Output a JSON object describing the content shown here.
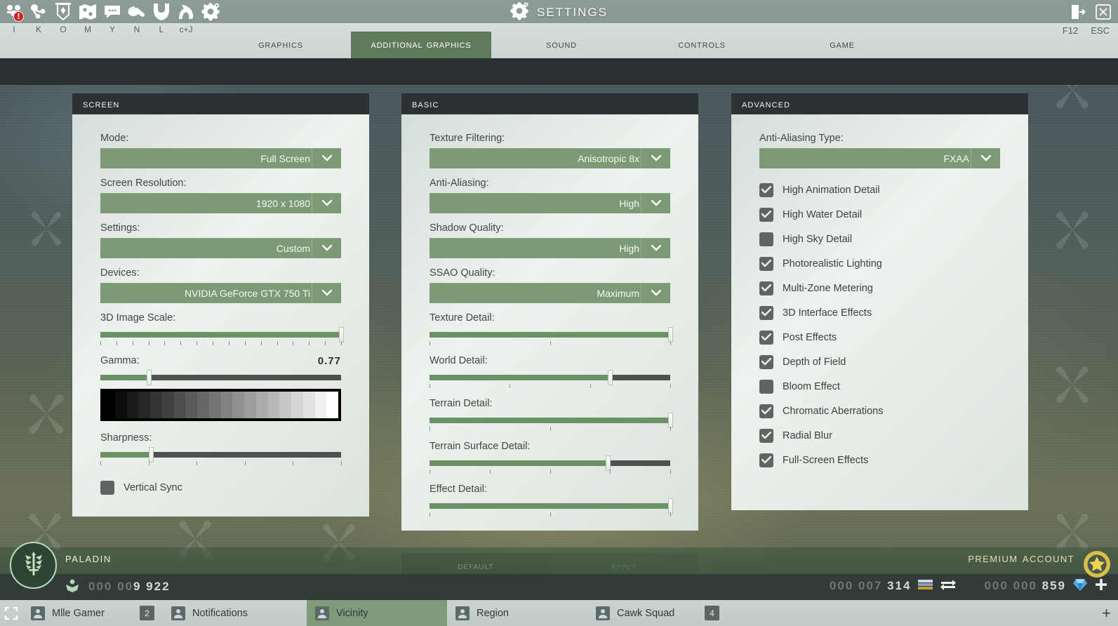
{
  "window": {
    "title": "Settings",
    "close_key": "ESC",
    "logout_key": "F12"
  },
  "quickbar": {
    "icons": [
      {
        "name": "guild-icon",
        "hotkey": "I",
        "badge": "!"
      },
      {
        "name": "social-icon",
        "hotkey": "K",
        "badge": ""
      },
      {
        "name": "banner-icon",
        "hotkey": "O",
        "badge": ""
      },
      {
        "name": "map-icon",
        "hotkey": "M",
        "badge": ""
      },
      {
        "name": "chat-icon",
        "hotkey": "Y",
        "badge": ""
      },
      {
        "name": "handshake-icon",
        "hotkey": "N",
        "badge": ""
      },
      {
        "name": "helmet-icon",
        "hotkey": "L",
        "badge": ""
      },
      {
        "name": "mount-icon",
        "hotkey": "c+J",
        "badge": ""
      },
      {
        "name": "settings-gear-icon",
        "hotkey": "",
        "badge": ""
      }
    ]
  },
  "tabs": [
    {
      "label": "Graphics",
      "active": false
    },
    {
      "label": "Additional Graphics",
      "active": true
    },
    {
      "label": "Sound",
      "active": false
    },
    {
      "label": "Controls",
      "active": false
    },
    {
      "label": "Game",
      "active": false
    }
  ],
  "panels": {
    "screen": {
      "title": "Screen",
      "fields": {
        "mode_label": "Mode:",
        "mode_value": "Full Screen",
        "resolution_label": "Screen Resolution:",
        "resolution_value": "1920 x 1080",
        "settings_label": "Settings:",
        "settings_value": "Custom",
        "devices_label": "Devices:",
        "devices_value": "NVIDIA GeForce GTX 750 Ti",
        "image_scale_label": "3D Image Scale:",
        "image_scale_pct": 100,
        "image_scale_ticks": 16,
        "gamma_label": "Gamma:",
        "gamma_value": "0.77",
        "gamma_pct": 20,
        "sharpness_label": "Sharpness:",
        "sharpness_pct": 21,
        "sharpness_ticks": 6,
        "vsync_label": "Vertical Sync",
        "vsync_checked": false
      }
    },
    "basic": {
      "title": "Basic",
      "fields": {
        "texture_filtering_label": "Texture Filtering:",
        "texture_filtering_value": "Anisotropic 8x",
        "anti_aliasing_label": "Anti-Aliasing:",
        "anti_aliasing_value": "High",
        "shadow_quality_label": "Shadow Quality:",
        "shadow_quality_value": "High",
        "ssao_quality_label": "SSAO Quality:",
        "ssao_quality_value": "Maximum",
        "texture_detail_label": "Texture Detail:",
        "texture_detail_pct": 100,
        "texture_detail_ticks": 3,
        "world_detail_label": "World Detail:",
        "world_detail_pct": 75,
        "world_detail_ticks": 4,
        "terrain_detail_label": "Terrain Detail:",
        "terrain_detail_pct": 100,
        "terrain_detail_ticks": 3,
        "terrain_surface_detail_label": "Terrain Surface Detail:",
        "terrain_surface_detail_pct": 74,
        "terrain_surface_detail_ticks": 5,
        "effect_detail_label": "Effect Detail:",
        "effect_detail_pct": 100,
        "effect_detail_ticks": 3
      }
    },
    "advanced": {
      "title": "Advanced",
      "fields": {
        "aa_type_label": "Anti-Aliasing Type:",
        "aa_type_value": "FXAA"
      },
      "checkboxes": [
        {
          "label": "High Animation Detail",
          "checked": true
        },
        {
          "label": "High Water Detail",
          "checked": true
        },
        {
          "label": "High Sky Detail",
          "checked": false
        },
        {
          "label": "Photorealistic Lighting",
          "checked": true
        },
        {
          "label": "Multi-Zone Metering",
          "checked": true
        },
        {
          "label": "3D Interface Effects",
          "checked": true
        },
        {
          "label": "Post Effects",
          "checked": true
        },
        {
          "label": "Depth of Field",
          "checked": true
        },
        {
          "label": "Bloom Effect",
          "checked": false
        },
        {
          "label": "Chromatic Aberrations",
          "checked": true
        },
        {
          "label": "Radial Blur",
          "checked": true
        },
        {
          "label": "Full-Screen Effects",
          "checked": true
        }
      ]
    }
  },
  "actions": {
    "default_label": "Default",
    "apply_label": "Apply"
  },
  "hud": {
    "character_name": "Paladin",
    "rank_value_dim": "000 00",
    "rank_value": "9 922",
    "premium_label": "Premium Account",
    "gold_dim": "000 007",
    "gold_value": " 314",
    "crystal_dim": "000 000 ",
    "crystal_value": "859"
  },
  "taskbar": {
    "tabs": [
      {
        "label": "Mlle Gamer",
        "count": "2",
        "active": false
      },
      {
        "label": "Notifications",
        "count": "",
        "active": false
      },
      {
        "label": "Vicinity",
        "count": "",
        "active": true
      },
      {
        "label": "Region",
        "count": "",
        "active": false
      },
      {
        "label": "Cawk Squad",
        "count": "4",
        "active": false
      }
    ],
    "add_label": "+"
  },
  "colors": {
    "accent_green": "#7d9a76",
    "panel_header": "#2c3133",
    "slider_fill": "#6d9167",
    "slider_track": "#4e5150",
    "tab_active": "#5f7a5b",
    "premium_gold": "#e4dfb4"
  }
}
